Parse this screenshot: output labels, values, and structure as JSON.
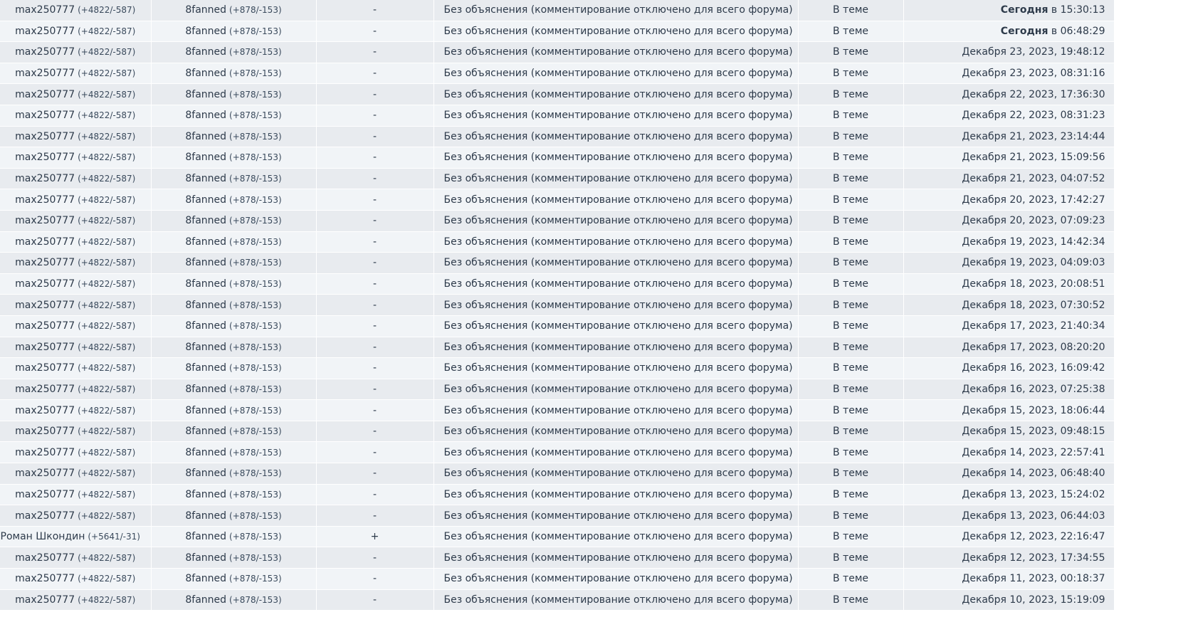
{
  "reason_text": "Без объяснения (комментирование отключено для всего форума)",
  "where_text": "В теме",
  "rows": [
    {
      "giver": "max250777",
      "giver_score": "(+4822/-587)",
      "receiver": "8fanned",
      "receiver_score": "(+878/-153)",
      "vote": "-",
      "date_bold": "Сегодня",
      "date_rest": " в 15:30:13"
    },
    {
      "giver": "max250777",
      "giver_score": "(+4822/-587)",
      "receiver": "8fanned",
      "receiver_score": "(+878/-153)",
      "vote": "-",
      "date_bold": "Сегодня",
      "date_rest": " в 06:48:29"
    },
    {
      "giver": "max250777",
      "giver_score": "(+4822/-587)",
      "receiver": "8fanned",
      "receiver_score": "(+878/-153)",
      "vote": "-",
      "date_bold": "",
      "date_rest": "Декабря 23, 2023, 19:48:12"
    },
    {
      "giver": "max250777",
      "giver_score": "(+4822/-587)",
      "receiver": "8fanned",
      "receiver_score": "(+878/-153)",
      "vote": "-",
      "date_bold": "",
      "date_rest": "Декабря 23, 2023, 08:31:16"
    },
    {
      "giver": "max250777",
      "giver_score": "(+4822/-587)",
      "receiver": "8fanned",
      "receiver_score": "(+878/-153)",
      "vote": "-",
      "date_bold": "",
      "date_rest": "Декабря 22, 2023, 17:36:30"
    },
    {
      "giver": "max250777",
      "giver_score": "(+4822/-587)",
      "receiver": "8fanned",
      "receiver_score": "(+878/-153)",
      "vote": "-",
      "date_bold": "",
      "date_rest": "Декабря 22, 2023, 08:31:23"
    },
    {
      "giver": "max250777",
      "giver_score": "(+4822/-587)",
      "receiver": "8fanned",
      "receiver_score": "(+878/-153)",
      "vote": "-",
      "date_bold": "",
      "date_rest": "Декабря 21, 2023, 23:14:44"
    },
    {
      "giver": "max250777",
      "giver_score": "(+4822/-587)",
      "receiver": "8fanned",
      "receiver_score": "(+878/-153)",
      "vote": "-",
      "date_bold": "",
      "date_rest": "Декабря 21, 2023, 15:09:56"
    },
    {
      "giver": "max250777",
      "giver_score": "(+4822/-587)",
      "receiver": "8fanned",
      "receiver_score": "(+878/-153)",
      "vote": "-",
      "date_bold": "",
      "date_rest": "Декабря 21, 2023, 04:07:52"
    },
    {
      "giver": "max250777",
      "giver_score": "(+4822/-587)",
      "receiver": "8fanned",
      "receiver_score": "(+878/-153)",
      "vote": "-",
      "date_bold": "",
      "date_rest": "Декабря 20, 2023, 17:42:27"
    },
    {
      "giver": "max250777",
      "giver_score": "(+4822/-587)",
      "receiver": "8fanned",
      "receiver_score": "(+878/-153)",
      "vote": "-",
      "date_bold": "",
      "date_rest": "Декабря 20, 2023, 07:09:23"
    },
    {
      "giver": "max250777",
      "giver_score": "(+4822/-587)",
      "receiver": "8fanned",
      "receiver_score": "(+878/-153)",
      "vote": "-",
      "date_bold": "",
      "date_rest": "Декабря 19, 2023, 14:42:34"
    },
    {
      "giver": "max250777",
      "giver_score": "(+4822/-587)",
      "receiver": "8fanned",
      "receiver_score": "(+878/-153)",
      "vote": "-",
      "date_bold": "",
      "date_rest": "Декабря 19, 2023, 04:09:03"
    },
    {
      "giver": "max250777",
      "giver_score": "(+4822/-587)",
      "receiver": "8fanned",
      "receiver_score": "(+878/-153)",
      "vote": "-",
      "date_bold": "",
      "date_rest": "Декабря 18, 2023, 20:08:51"
    },
    {
      "giver": "max250777",
      "giver_score": "(+4822/-587)",
      "receiver": "8fanned",
      "receiver_score": "(+878/-153)",
      "vote": "-",
      "date_bold": "",
      "date_rest": "Декабря 18, 2023, 07:30:52"
    },
    {
      "giver": "max250777",
      "giver_score": "(+4822/-587)",
      "receiver": "8fanned",
      "receiver_score": "(+878/-153)",
      "vote": "-",
      "date_bold": "",
      "date_rest": "Декабря 17, 2023, 21:40:34"
    },
    {
      "giver": "max250777",
      "giver_score": "(+4822/-587)",
      "receiver": "8fanned",
      "receiver_score": "(+878/-153)",
      "vote": "-",
      "date_bold": "",
      "date_rest": "Декабря 17, 2023, 08:20:20"
    },
    {
      "giver": "max250777",
      "giver_score": "(+4822/-587)",
      "receiver": "8fanned",
      "receiver_score": "(+878/-153)",
      "vote": "-",
      "date_bold": "",
      "date_rest": "Декабря 16, 2023, 16:09:42"
    },
    {
      "giver": "max250777",
      "giver_score": "(+4822/-587)",
      "receiver": "8fanned",
      "receiver_score": "(+878/-153)",
      "vote": "-",
      "date_bold": "",
      "date_rest": "Декабря 16, 2023, 07:25:38"
    },
    {
      "giver": "max250777",
      "giver_score": "(+4822/-587)",
      "receiver": "8fanned",
      "receiver_score": "(+878/-153)",
      "vote": "-",
      "date_bold": "",
      "date_rest": "Декабря 15, 2023, 18:06:44"
    },
    {
      "giver": "max250777",
      "giver_score": "(+4822/-587)",
      "receiver": "8fanned",
      "receiver_score": "(+878/-153)",
      "vote": "-",
      "date_bold": "",
      "date_rest": "Декабря 15, 2023, 09:48:15"
    },
    {
      "giver": "max250777",
      "giver_score": "(+4822/-587)",
      "receiver": "8fanned",
      "receiver_score": "(+878/-153)",
      "vote": "-",
      "date_bold": "",
      "date_rest": "Декабря 14, 2023, 22:57:41"
    },
    {
      "giver": "max250777",
      "giver_score": "(+4822/-587)",
      "receiver": "8fanned",
      "receiver_score": "(+878/-153)",
      "vote": "-",
      "date_bold": "",
      "date_rest": "Декабря 14, 2023, 06:48:40"
    },
    {
      "giver": "max250777",
      "giver_score": "(+4822/-587)",
      "receiver": "8fanned",
      "receiver_score": "(+878/-153)",
      "vote": "-",
      "date_bold": "",
      "date_rest": "Декабря 13, 2023, 15:24:02"
    },
    {
      "giver": "max250777",
      "giver_score": "(+4822/-587)",
      "receiver": "8fanned",
      "receiver_score": "(+878/-153)",
      "vote": "-",
      "date_bold": "",
      "date_rest": "Декабря 13, 2023, 06:44:03"
    },
    {
      "giver": "Роман Шкондин",
      "giver_score": "(+5641/-31)",
      "receiver": "8fanned",
      "receiver_score": "(+878/-153)",
      "vote": "+",
      "date_bold": "",
      "date_rest": "Декабря 12, 2023, 22:16:47"
    },
    {
      "giver": "max250777",
      "giver_score": "(+4822/-587)",
      "receiver": "8fanned",
      "receiver_score": "(+878/-153)",
      "vote": "-",
      "date_bold": "",
      "date_rest": "Декабря 12, 2023, 17:34:55"
    },
    {
      "giver": "max250777",
      "giver_score": "(+4822/-587)",
      "receiver": "8fanned",
      "receiver_score": "(+878/-153)",
      "vote": "-",
      "date_bold": "",
      "date_rest": "Декабря 11, 2023, 00:18:37"
    },
    {
      "giver": "max250777",
      "giver_score": "(+4822/-587)",
      "receiver": "8fanned",
      "receiver_score": "(+878/-153)",
      "vote": "-",
      "date_bold": "",
      "date_rest": "Декабря 10, 2023, 15:19:09"
    }
  ]
}
